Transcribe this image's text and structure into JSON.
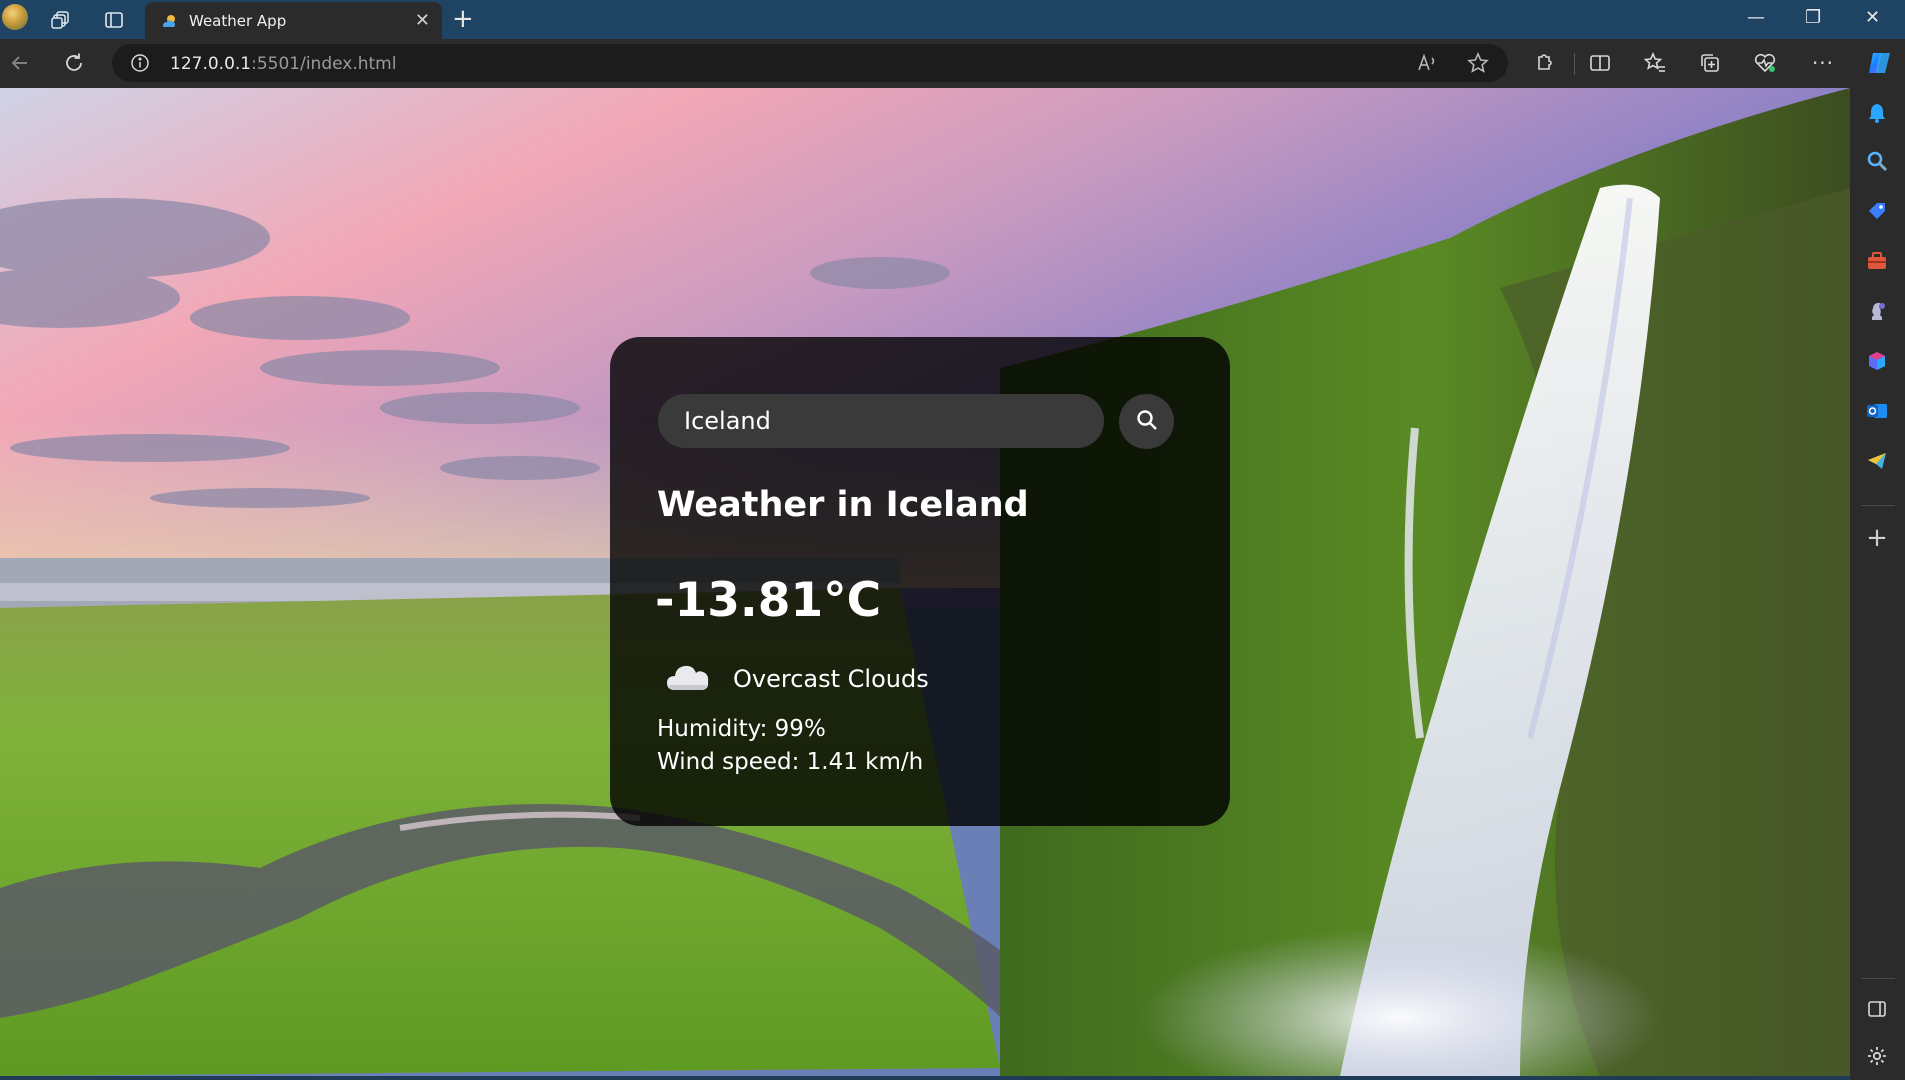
{
  "browser": {
    "tab_title": "Weather App",
    "url_host": "127.0.0.1",
    "url_rest": ":5501/index.html",
    "new_tab_glyph": "+",
    "close_tab_glyph": "✕",
    "icons": {
      "workspaces": "workspaces-icon",
      "tab_actions": "tab-actions-icon",
      "back": "back-arrow-icon",
      "refresh": "refresh-icon",
      "site_info": "info-icon",
      "read_aloud": "read-aloud-icon",
      "favorite": "star-icon",
      "extensions": "extensions-icon",
      "split_screen": "split-screen-icon",
      "favorites": "favorites-icon",
      "collections": "collections-icon",
      "browser_essentials": "heart-pulse-icon",
      "more": "more-icon",
      "copilot": "copilot-icon"
    }
  },
  "sidebar": {
    "items": [
      "bell-icon",
      "search-icon",
      "shopping-tag-icon",
      "tools-icon",
      "games-icon",
      "office-icon",
      "outlook-icon",
      "telegram-icon",
      "add-icon",
      "sidebar-toggle-icon",
      "settings-icon"
    ]
  },
  "weather": {
    "search_value": "Iceland",
    "title": "Weather in Iceland",
    "temperature": "-13.81°C",
    "description": "Overcast Clouds",
    "condition_icon": "cloud-icon",
    "humidity": "Humidity: 99%",
    "wind": "Wind speed: 1.41 km/h"
  },
  "colors": {
    "card_bg": "rgba(0,0,0,0.8)",
    "input_bg": "#3a3a3a",
    "titlebar": "#1e4363",
    "toolbar": "#2b2b2b",
    "copilot_accent": "#1a9fff"
  }
}
